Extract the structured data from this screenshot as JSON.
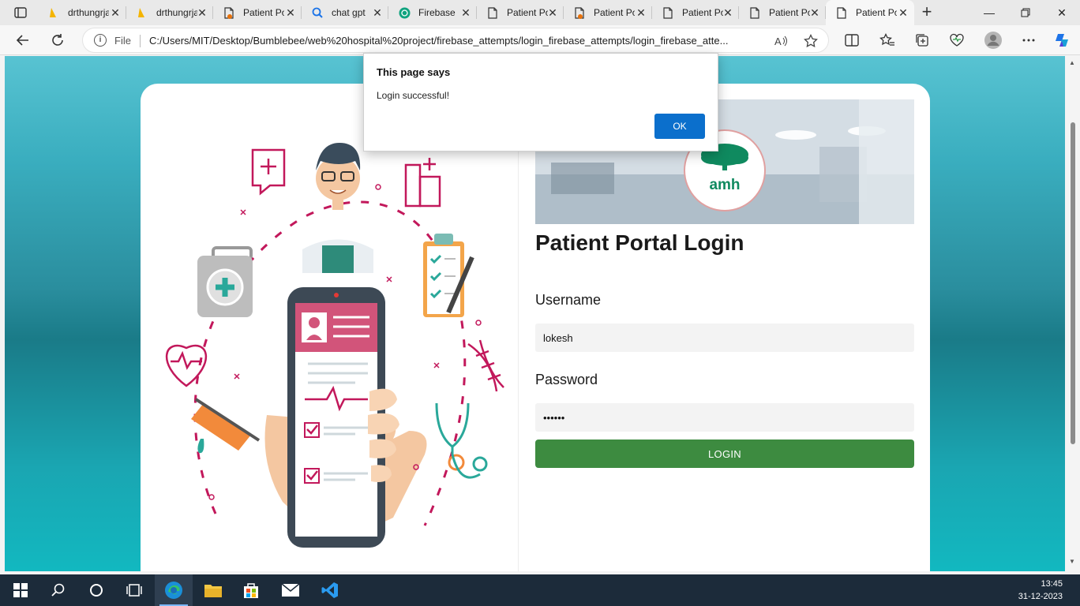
{
  "browser": {
    "tabs": [
      {
        "title": "drthungrjay",
        "icon": "drive-icon",
        "active": false,
        "orange_dot": false
      },
      {
        "title": "drthungrjay",
        "icon": "drive-icon",
        "active": false,
        "orange_dot": false
      },
      {
        "title": "Patient Portal",
        "icon": "page-icon",
        "active": false,
        "orange_dot": true
      },
      {
        "title": "chat gpt",
        "icon": "search-icon",
        "active": false,
        "orange_dot": false
      },
      {
        "title": "Firebase",
        "icon": "openai-icon",
        "active": false,
        "orange_dot": false
      },
      {
        "title": "Patient Portal",
        "icon": "page-icon",
        "active": false,
        "orange_dot": false
      },
      {
        "title": "Patient Portal",
        "icon": "page-icon",
        "active": false,
        "orange_dot": true
      },
      {
        "title": "Patient Portal",
        "icon": "page-icon",
        "active": false,
        "orange_dot": false
      },
      {
        "title": "Patient Portal",
        "icon": "page-icon",
        "active": false,
        "orange_dot": false
      },
      {
        "title": "Patient Portal",
        "icon": "page-icon",
        "active": true,
        "orange_dot": false
      }
    ],
    "address": {
      "scheme_label": "File",
      "url": "C:/Users/MIT/Desktop/Bumblebee/web%20hospital%20project/firebase_attempts/login_firebase_attempts/login_firebase_atte..."
    }
  },
  "page": {
    "banner_logo_text": "amh",
    "title": "Patient Portal Login",
    "username": {
      "label": "Username",
      "value": "lokesh"
    },
    "password": {
      "label": "Password",
      "value": "lokesh"
    },
    "login_button": "LOGIN",
    "colors": {
      "button": "#3d8b40",
      "background_top": "#58c3d2",
      "background_mid": "#1a7b88"
    }
  },
  "dialog": {
    "title": "This page says",
    "message": "Login successful!",
    "ok_label": "OK"
  },
  "taskbar": {
    "apps": [
      "start-icon",
      "search-icon",
      "cortana-icon",
      "task-view-icon",
      "edge-icon",
      "file-explorer-icon",
      "store-icon",
      "mail-icon",
      "vscode-icon"
    ],
    "time": "13:45",
    "date": "31-12-2023"
  }
}
